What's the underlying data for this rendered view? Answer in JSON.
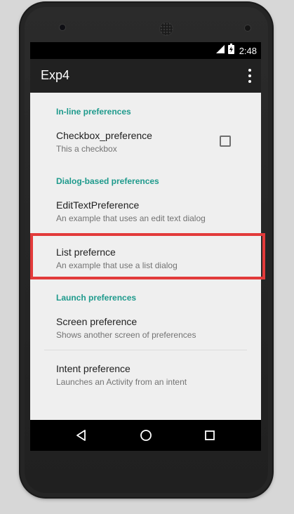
{
  "status_bar": {
    "time": "2:48"
  },
  "app_bar": {
    "title": "Exp4"
  },
  "categories": {
    "inline": "In-line preferences",
    "dialog": "Dialog-based preferences",
    "launch": "Launch preferences"
  },
  "preferences": {
    "checkbox": {
      "title": "Checkbox_preference",
      "summary": "This a checkbox",
      "checked": false
    },
    "edittext": {
      "title": "EditTextPreference",
      "summary": "An example that uses an edit text dialog"
    },
    "list": {
      "title": "List prefernce",
      "summary": "An example that use a list dialog"
    },
    "screen": {
      "title": "Screen preference",
      "summary": "Shows another screen of preferences"
    },
    "intent": {
      "title": "Intent preference",
      "summary": "Launches an Activity from an intent"
    }
  },
  "colors": {
    "accent": "#1e9a8c",
    "highlight": "#e23a3a",
    "app_bar": "#212121",
    "background": "#efefef"
  },
  "icons": {
    "status": [
      "signal-icon",
      "battery-icon"
    ],
    "nav": [
      "back-icon",
      "home-icon",
      "recents-icon"
    ],
    "menu": "overflow-menu-icon"
  }
}
